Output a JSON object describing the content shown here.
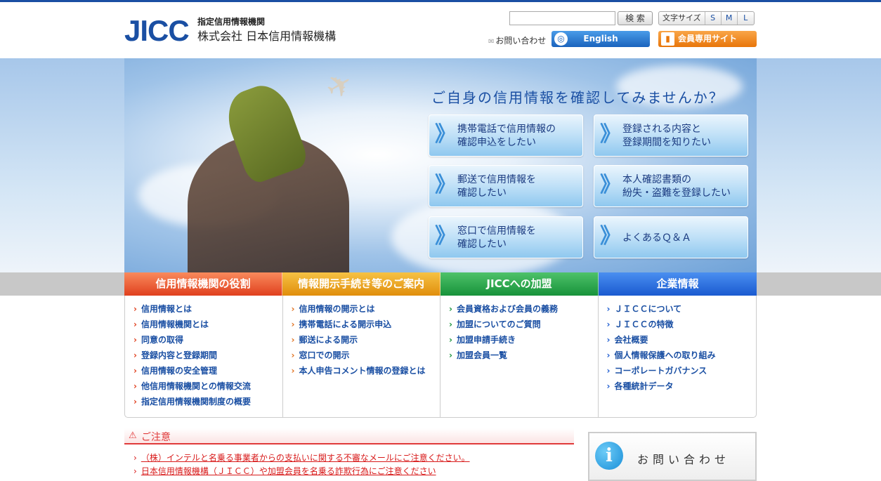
{
  "header": {
    "logo_mark": "JICC",
    "logo_sub": "指定信用情報機関",
    "logo_name": "株式会社 日本信用情報機構",
    "search_button": "検 索",
    "font_size_label": "文字サイズ",
    "font_sizes": [
      "S",
      "M",
      "L"
    ],
    "contact_link": "お問い合わせ",
    "english_button": "English",
    "member_button": "会員専用サイト"
  },
  "hero": {
    "title": "ご自身の信用情報を確認してみませんか？",
    "buttons": [
      {
        "line1": "携帯電話で信用情報の",
        "line2": "確認申込をしたい"
      },
      {
        "line1": "登録される内容と",
        "line2": "登録期間を知りたい"
      },
      {
        "line1": "郵送で信用情報を",
        "line2": "確認したい"
      },
      {
        "line1": "本人確認書類の",
        "line2": "紛失・盗難を登録したい"
      },
      {
        "line1": "窓口で信用情報を",
        "line2": "確認したい"
      },
      {
        "line1": "よくあるＱ＆Ａ",
        "line2": ""
      }
    ]
  },
  "nav": {
    "tabs": [
      "信用情報機関の役割",
      "情報開示手続き等のご案内",
      "JICCへの加盟",
      "企業情報"
    ],
    "columns": [
      [
        "信用情報とは",
        "信用情報機関とは",
        "同意の取得",
        "登録内容と登録期間",
        "信用情報の安全管理",
        "他信用情報機関との情報交流",
        "指定信用情報機関制度の概要"
      ],
      [
        "信用情報の開示とは",
        "携帯電話による開示申込",
        "郵送による開示",
        "窓口での開示",
        "本人申告コメント情報の登録とは"
      ],
      [
        "会員資格および会員の義務",
        "加盟についてのご質問",
        "加盟申請手続き",
        "加盟会員一覧"
      ],
      [
        "ＪＩＣＣについて",
        "ＪＩＣＣの特徴",
        "会社概要",
        "個人情報保護への取り組み",
        "コーポレートガバナンス",
        "各種統計データ"
      ]
    ]
  },
  "notice": {
    "title": "ご注意",
    "items": [
      "（株）インテルと名乗る事業者からの支払いに関する不審なメールにご注意ください。",
      "日本信用情報機構（ＪＩＣＣ）や加盟会員を名乗る詐欺行為にご注意ください"
    ]
  },
  "contact_panel": {
    "icon_glyph": "i",
    "label": "お問い合わせ"
  },
  "colors": {
    "brand_blue": "#1a4fa3",
    "tab1": "#e0401e",
    "tab2": "#e08e0c",
    "tab3": "#17923a",
    "tab4": "#1a5ad0",
    "warning_red": "#e03a3a"
  }
}
